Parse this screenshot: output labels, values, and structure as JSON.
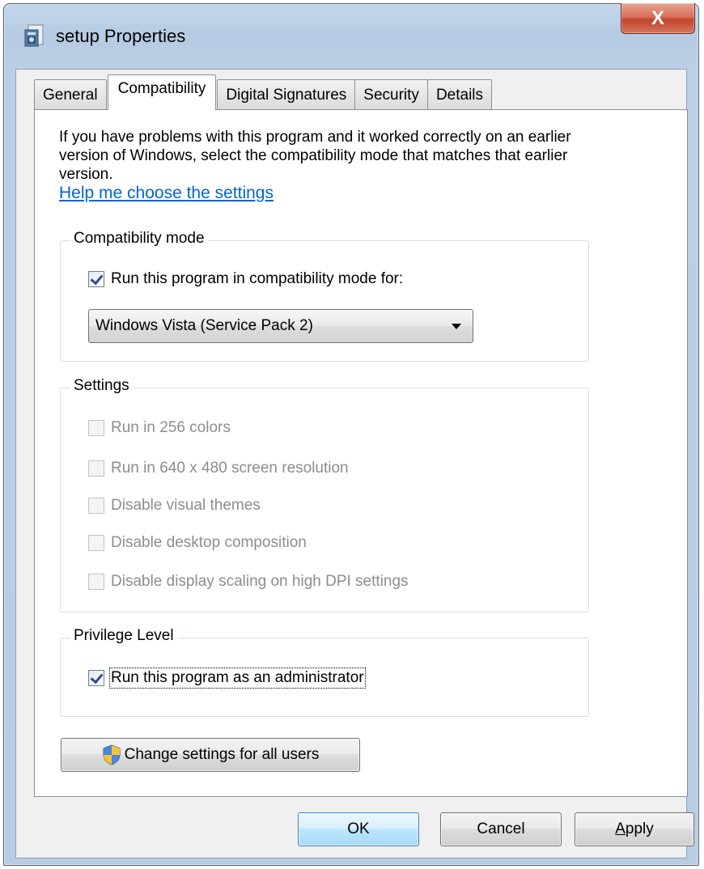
{
  "window": {
    "title": "setup Properties",
    "close_symbol": "X",
    "app_icon": "setup-file-icon"
  },
  "tabs": [
    {
      "label": "General",
      "active": false
    },
    {
      "label": "Compatibility",
      "active": true
    },
    {
      "label": "Digital Signatures",
      "active": false
    },
    {
      "label": "Security",
      "active": false
    },
    {
      "label": "Details",
      "active": false
    }
  ],
  "compat": {
    "intro": "If you have problems with this program and it worked correctly on an earlier version of Windows, select the compatibility mode that matches that earlier version.",
    "help_link": "Help me choose the settings",
    "mode_group": {
      "title": "Compatibility mode",
      "run_compat_label": "Run this program in compatibility mode for:",
      "run_compat_checked": true,
      "selected_mode": "Windows Vista (Service Pack 2)"
    },
    "settings_group": {
      "title": "Settings",
      "options": [
        {
          "label": "Run in 256 colors",
          "checked": false,
          "enabled": false
        },
        {
          "label": "Run in 640 x 480 screen resolution",
          "checked": false,
          "enabled": false
        },
        {
          "label": "Disable visual themes",
          "checked": false,
          "enabled": false
        },
        {
          "label": "Disable desktop composition",
          "checked": false,
          "enabled": false
        },
        {
          "label": "Disable display scaling on high DPI settings",
          "checked": false,
          "enabled": false
        }
      ]
    },
    "privilege_group": {
      "title": "Privilege Level",
      "run_admin_label": "Run this program as an administrator",
      "run_admin_checked": true
    },
    "change_all_users_label": "Change settings for all users",
    "shield_icon": "uac-shield-icon"
  },
  "footer": {
    "ok_label": "OK",
    "cancel_label": "Cancel",
    "apply_accel": "A",
    "apply_rest": "pply"
  },
  "colors": {
    "link": "#0066cc",
    "close_button": "#c0442b",
    "default_button": "#bee6fd",
    "disabled_text": "#8d8d8d"
  }
}
